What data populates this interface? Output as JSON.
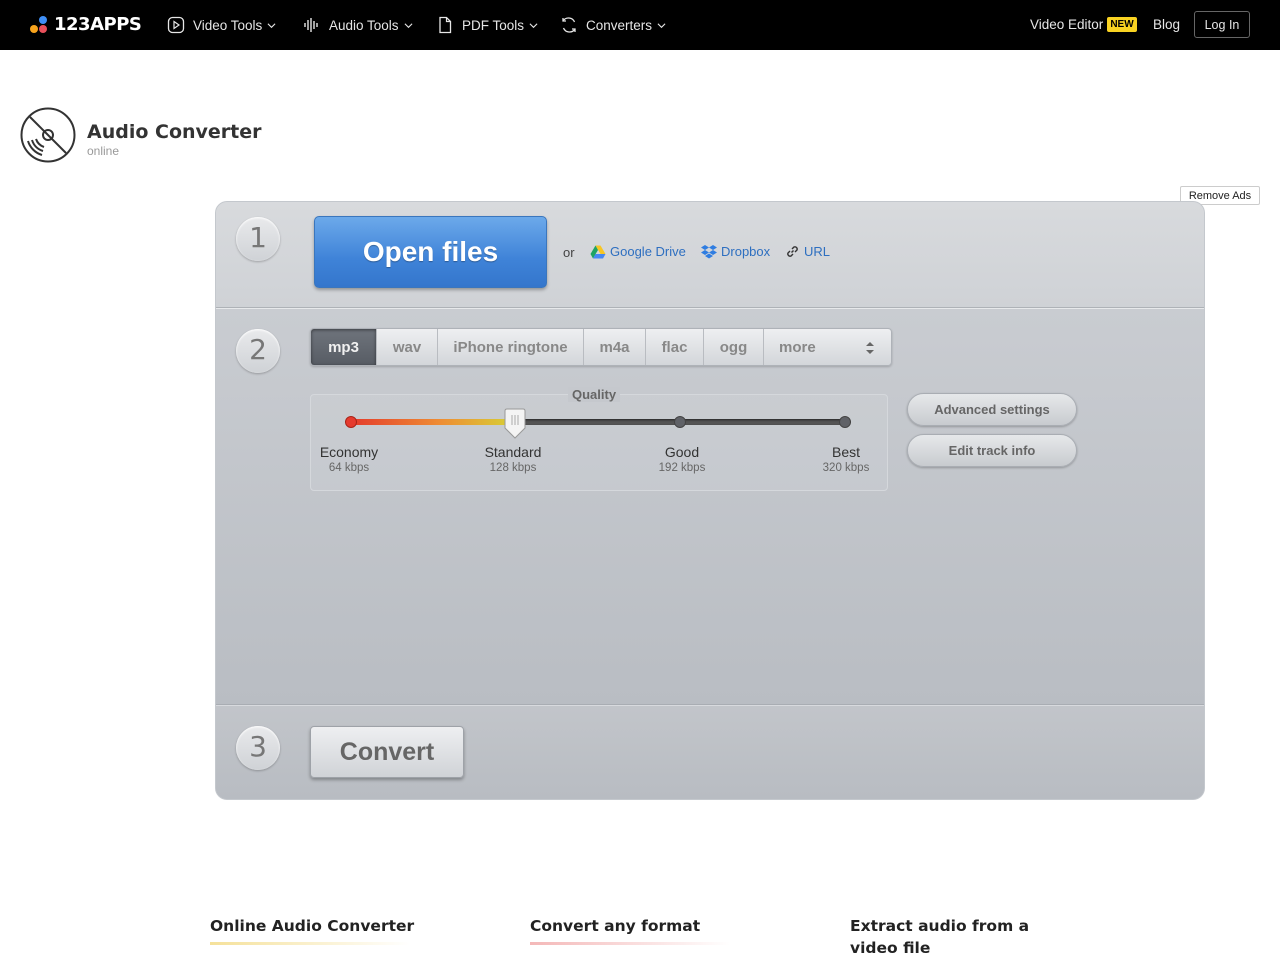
{
  "nav": {
    "brand": "123APPS",
    "items": [
      {
        "label": "Video Tools",
        "icon": "play-square-icon"
      },
      {
        "label": "Audio Tools",
        "icon": "waveform-icon"
      },
      {
        "label": "PDF Tools",
        "icon": "document-icon"
      },
      {
        "label": "Converters",
        "icon": "convert-cycle-icon"
      }
    ],
    "video_editor": "Video Editor",
    "new_badge": "NEW",
    "blog": "Blog",
    "login": "Log In"
  },
  "app": {
    "title": "Audio Converter",
    "subtitle": "online",
    "remove_ads": "Remove Ads"
  },
  "step1": {
    "number": "1",
    "open_files": "Open files",
    "or": "or",
    "sources": [
      "Google Drive",
      "Dropbox",
      "URL"
    ]
  },
  "step2": {
    "number": "2",
    "formats": [
      "mp3",
      "wav",
      "iPhone ringtone",
      "m4a",
      "flac",
      "ogg",
      "more"
    ],
    "selected_format": "mp3",
    "quality": {
      "title": "Quality",
      "selected": "Standard",
      "level_fraction": 0.33,
      "levels": [
        {
          "name": "Economy",
          "bitrate": "64 kbps"
        },
        {
          "name": "Standard",
          "bitrate": "128 kbps"
        },
        {
          "name": "Good",
          "bitrate": "192 kbps"
        },
        {
          "name": "Best",
          "bitrate": "320 kbps"
        }
      ]
    },
    "advanced_settings": "Advanced settings",
    "edit_track_info": "Edit track info"
  },
  "step3": {
    "number": "3",
    "convert": "Convert"
  },
  "footer": {
    "headings": [
      "Online Audio Converter",
      "Convert any format",
      "Extract audio from a video file"
    ]
  },
  "colors": {
    "accent_blue": "#3f83d8",
    "badge_yellow": "#f9d322",
    "nav_bg": "#000000",
    "link_blue": "#2d6fc0"
  }
}
